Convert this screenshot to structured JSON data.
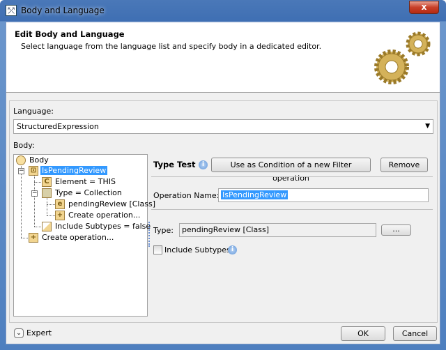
{
  "window": {
    "title": "Body and Language",
    "close_label": "x"
  },
  "header": {
    "title": "Edit Body and Language",
    "description": "Select language from the language list and specify body in a dedicated editor."
  },
  "language": {
    "label": "Language:",
    "value": "StructuredExpression"
  },
  "body": {
    "label": "Body:",
    "tree": [
      "Body",
      "IsPendingReview",
      "Element = THIS",
      "Type = Collection",
      "pendingReview [Class]",
      "Create operation...",
      "Include Subtypes = false",
      "Create operation..."
    ]
  },
  "editor": {
    "section_title": "Type Test",
    "use_as_condition_label": "Use as Condition of a new Filter operation",
    "remove_label": "Remove",
    "operation_name_label": "Operation Name:",
    "operation_name_value": "IsPendingReview",
    "type_label": "Type:",
    "type_value": "pendingReview [Class]",
    "browse_label": "...",
    "include_subtypes_label": "Include Subtypes",
    "include_subtypes_checked": false
  },
  "footer": {
    "expert_label": "Expert",
    "ok_label": "OK",
    "cancel_label": "Cancel"
  }
}
